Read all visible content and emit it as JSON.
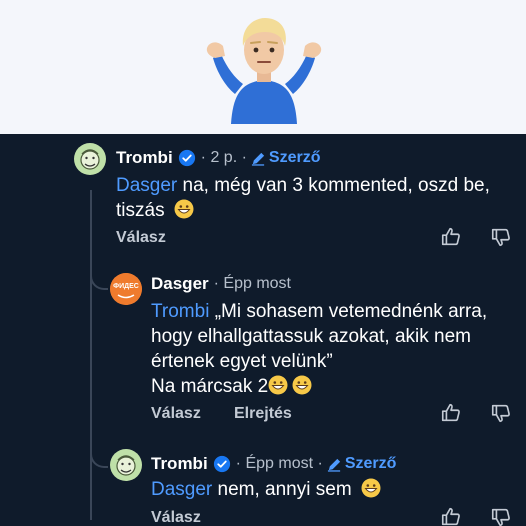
{
  "comments": [
    {
      "author": "Trombi",
      "meta": "· 2 p. ·",
      "author_badge": "Szerző",
      "mention": "Dasger",
      "text_line1": " na, még van 3 kommented, oszd be,",
      "text_line2": "tiszás",
      "reply_label": "Válasz"
    },
    {
      "author": "Dasger",
      "meta": "· Épp most",
      "avatar_text": "ФИДЕС",
      "mention": "Trombi",
      "text_line1": " „Mi sohasem vetemednénk arra,",
      "text_line2": "hogy elhallgattassuk azokat, akik nem",
      "text_line3": "értenek egyet velünk”",
      "text_line4": "Na márcsak 2",
      "reply_label": "Válasz",
      "hide_label": "Elrejtés"
    },
    {
      "author": "Trombi",
      "meta": "· Épp most ·",
      "author_badge": "Szerző",
      "mention": "Dasger",
      "text_line1": " nem, annyi sem",
      "reply_label": "Válasz"
    }
  ],
  "colors": {
    "background": "#0f1b2b",
    "link": "#4f9bff",
    "verified": "#1877f2",
    "banner": "#f4f6fb"
  }
}
